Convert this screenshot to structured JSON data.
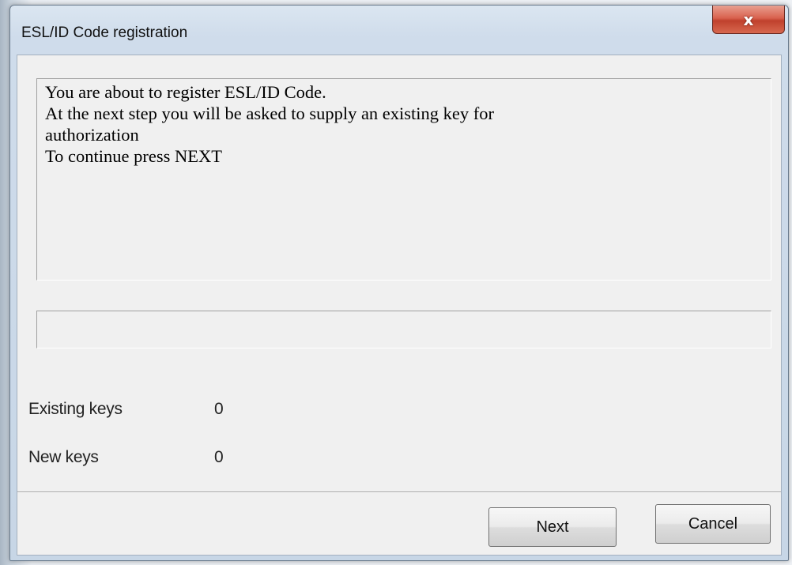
{
  "window": {
    "title": "ESL/ID Code registration",
    "close_glyph": "x"
  },
  "message": {
    "lines": [
      "You are about to register ESL/ID Code.",
      "At the next step you will be asked to supply an existing key for",
      "authorization",
      "To continue press NEXT"
    ]
  },
  "status": {
    "text": ""
  },
  "info": {
    "existing_keys_label": "Existing keys",
    "existing_keys_value": "0",
    "new_keys_label": "New keys",
    "new_keys_value": "0"
  },
  "buttons": {
    "next_label": "Next",
    "cancel_label": "Cancel"
  },
  "colors": {
    "close_button": "#c7452f",
    "dialog_background": "#f0f0f0",
    "title_bar": "#cfdceb"
  },
  "icons": {
    "close": "close-icon"
  }
}
